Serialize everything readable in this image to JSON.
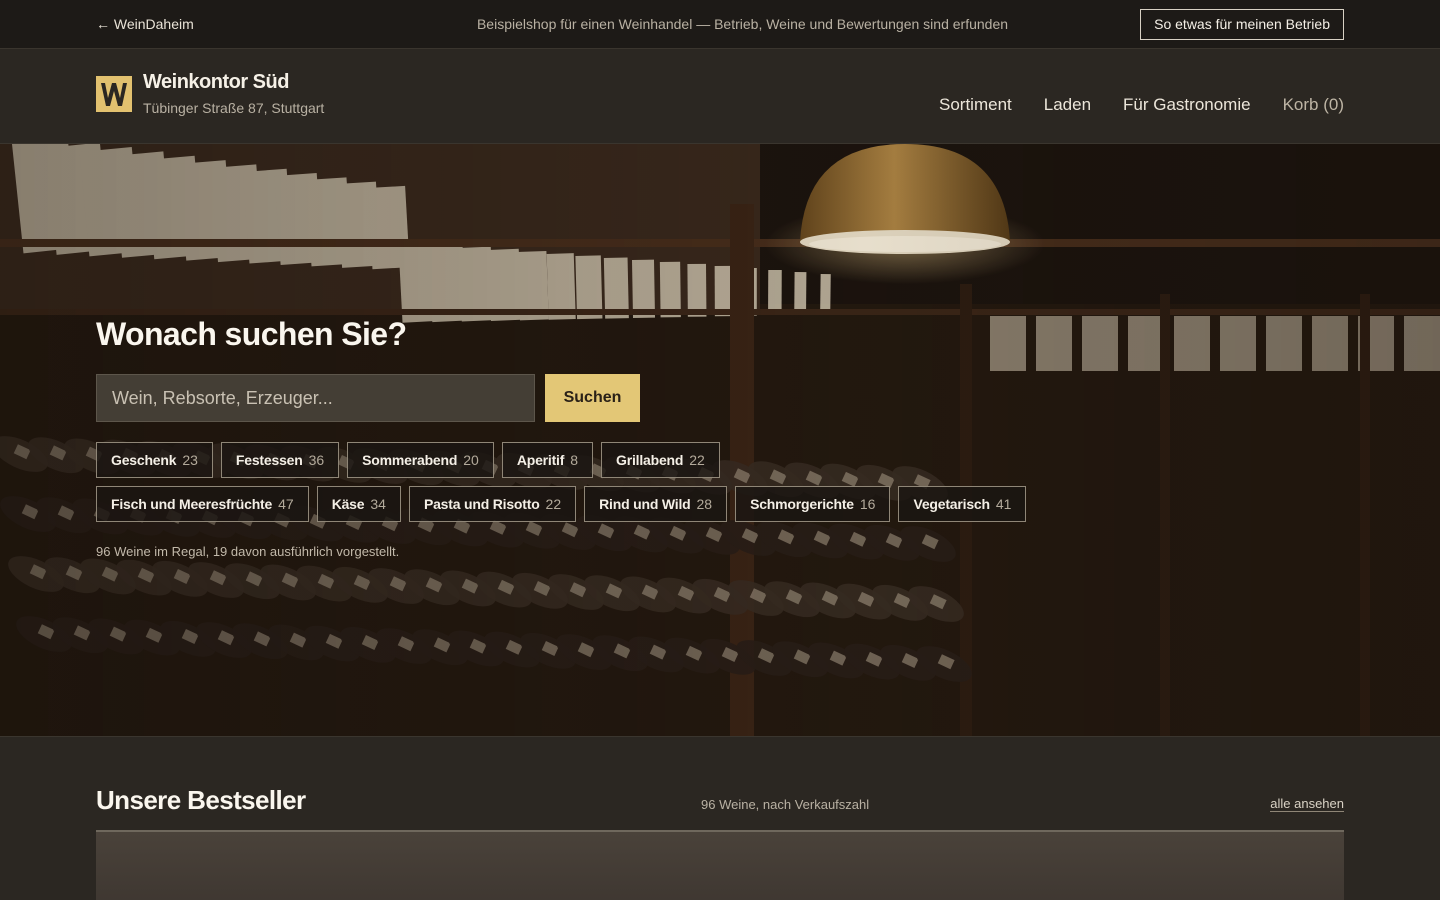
{
  "demo_bar": {
    "back_label": "← WeinDaheim",
    "note": "Beispielshop für einen Weinhandel — Betrieb, Weine und Bewertungen sind erfunden",
    "cta_label": "So etwas für meinen Betrieb"
  },
  "header": {
    "logo_letter": "W",
    "shop_name": "Weinkontor Süd",
    "address": "Tübinger Straße 87, Stuttgart",
    "nav": [
      "Sortiment",
      "Laden",
      "Für Gastronomie"
    ],
    "cart_label": "Korb (0)"
  },
  "hero": {
    "title": "Wonach suchen Sie?",
    "search_placeholder": "Wein, Rebsorte, Erzeuger...",
    "search_button": "Suchen",
    "chips_row1": [
      {
        "label": "Geschenk",
        "count": "23"
      },
      {
        "label": "Festessen",
        "count": "36"
      },
      {
        "label": "Sommerabend",
        "count": "20"
      },
      {
        "label": "Aperitif",
        "count": "8"
      },
      {
        "label": "Grillabend",
        "count": "22"
      }
    ],
    "chips_row2": [
      {
        "label": "Fisch und Meeresfrüchte",
        "count": "47"
      },
      {
        "label": "Käse",
        "count": "34"
      },
      {
        "label": "Pasta und Risotto",
        "count": "22"
      },
      {
        "label": "Rind und Wild",
        "count": "28"
      },
      {
        "label": "Schmorgerichte",
        "count": "16"
      },
      {
        "label": "Vegetarisch",
        "count": "41"
      }
    ],
    "stats": "96 Weine im Regal, 19 davon ausführlich vorgestellt."
  },
  "bestseller": {
    "title": "Unsere Bestseller",
    "subtitle": "96 Weine, nach Verkaufszahl",
    "link": "alle ansehen"
  },
  "colors": {
    "accent": "#e3c776",
    "background": "#2b2722",
    "bar": "#1d1a17"
  },
  "icons": {
    "logo": "w-monogram-icon",
    "hero_image": "wine-cellar-photo"
  }
}
